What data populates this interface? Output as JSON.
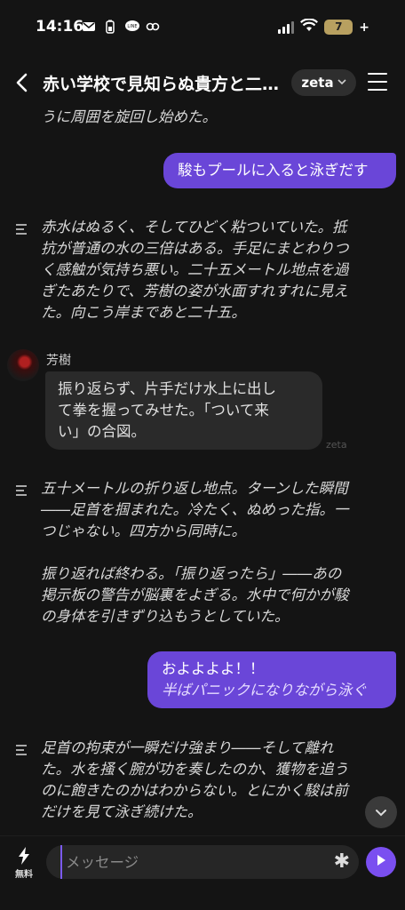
{
  "status_bar": {
    "time": "14:16",
    "battery": "7",
    "left_icons": [
      "mail-icon",
      "battery-saver-icon",
      "line-icon",
      "app-icon"
    ]
  },
  "header": {
    "title": "赤い学校で見知らぬ貴方と二…",
    "model_chip": "zeta"
  },
  "messages": {
    "partial_top": "うに周囲を旋回し始めた。",
    "user_1": "駿もプールに入ると泳ぎだす",
    "narr_1": "赤水はぬるく、そしてひどく粘ついていた。抵\n抗が普通の水の三倍はある。手足にまとわりつ\nく感触が気持ち悪い。二十五メートル地点を過\nぎたあたりで、芳樹の姿が水面すれすれに見え\nた。向こう岸まであと二十五。",
    "char_name": "芳樹",
    "char_1": "振り返らず、片手だけ水上に出し\nて拳を握ってみせた。「ついて来\nい」の合図。",
    "zeta_mark": "zeta",
    "narr_2": "五十メートルの折り返し地点。ターンした瞬間\n――足首を掴まれた。冷たく、ぬめった指。一\nつじゃない。四方から同時に。\n\n振り返れば終わる。「振り返ったら」――あの\n掲示板の警告が脳裏をよぎる。水中で何かが駿\nの身体を引きずり込もうとしていた。",
    "user_2_line1": "およよよよ！！",
    "user_2_line2": "半ばパニックになりながら泳ぐ",
    "narr_3": "足首の拘束が一瞬だけ強まり――そして離れ\nた。水を掻く腕が功を奏したのか、獲物を追う\nのに飽きたのかはわからない。とにかく駿は前\nだけを見て泳ぎ続けた。"
  },
  "composer": {
    "free_label": "無料",
    "placeholder": "メッセージ",
    "accent": "#7a4ff0"
  }
}
